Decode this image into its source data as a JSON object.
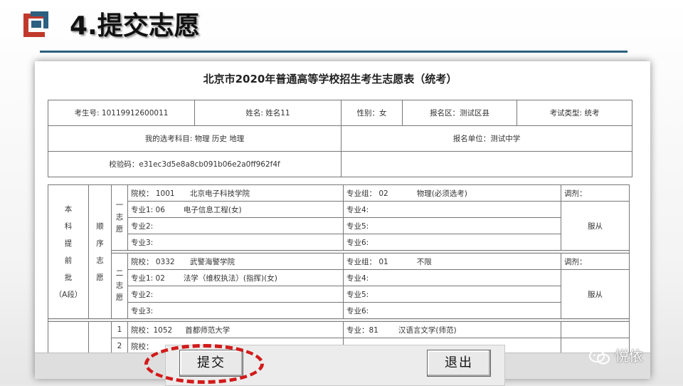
{
  "slide": {
    "title": "4.提交志愿"
  },
  "form": {
    "title": "北京市2020年普通高等学校招生考生志愿表（统考）",
    "exam_no": "考生号: 10119912600011",
    "name": "姓名: 姓名11",
    "gender": "性别：女",
    "region": "报名区：测试区县",
    "exam_type": "考试类型: 统考",
    "subjects": "我的选考科目: 物理 历史 地理",
    "unit": "报名单位：测试中学",
    "checksum": "校验码：e31ec3d5e8a8cb091b06e2a0ff962f4f"
  },
  "wish": {
    "batch_label": [
      "本",
      "科",
      "提",
      "前",
      "批",
      "（A段）"
    ],
    "order_label": [
      "顺",
      "序",
      "志",
      "愿"
    ],
    "groups": [
      {
        "ordinal": [
          "一",
          "志",
          "愿"
        ],
        "school_code": "院校：  1001",
        "school_name": "北京电子科技学院",
        "group_code": "专业组：  02",
        "group_req": "物理(必须选考)",
        "adjust_label": "调剂：",
        "adjust_value": "服从",
        "majors": [
          {
            "code": "专业1: 06",
            "name": "电子信息工程(女)"
          },
          {
            "code": "专业2:",
            "name": ""
          },
          {
            "code": "专业3:",
            "name": ""
          }
        ],
        "majors_right": [
          "专业4:",
          "专业5:",
          "专业6:"
        ]
      },
      {
        "ordinal": [
          "二",
          "志",
          "愿"
        ],
        "school_code": "院校：  0332",
        "school_name": "武警海警学院",
        "group_code": "专业组：  01",
        "group_req": "不限",
        "adjust_label": "调剂：",
        "adjust_value": "服从",
        "majors": [
          {
            "code": "专业1: 02",
            "name": "法学（维权执法）(指挥)(女)"
          },
          {
            "code": "专业2:",
            "name": ""
          },
          {
            "code": "专业3:",
            "name": ""
          }
        ],
        "majors_right": [
          "专业4:",
          "专业5:",
          "专业6:"
        ]
      }
    ],
    "next_rows": [
      {
        "num": "1",
        "school": "院校：1052",
        "school_name": "首都师范大学",
        "major": "专业：81",
        "major_name": "汉语言文学(师范)"
      },
      {
        "num": "2",
        "school": "院校："
      }
    ]
  },
  "buttons": {
    "submit": "提交",
    "exit": "退出"
  },
  "watermark": {
    "text": "悦依",
    "icon": "wechat-icon"
  },
  "colors": {
    "highlight": "#d21a1a",
    "rule": "#2c5f80"
  }
}
